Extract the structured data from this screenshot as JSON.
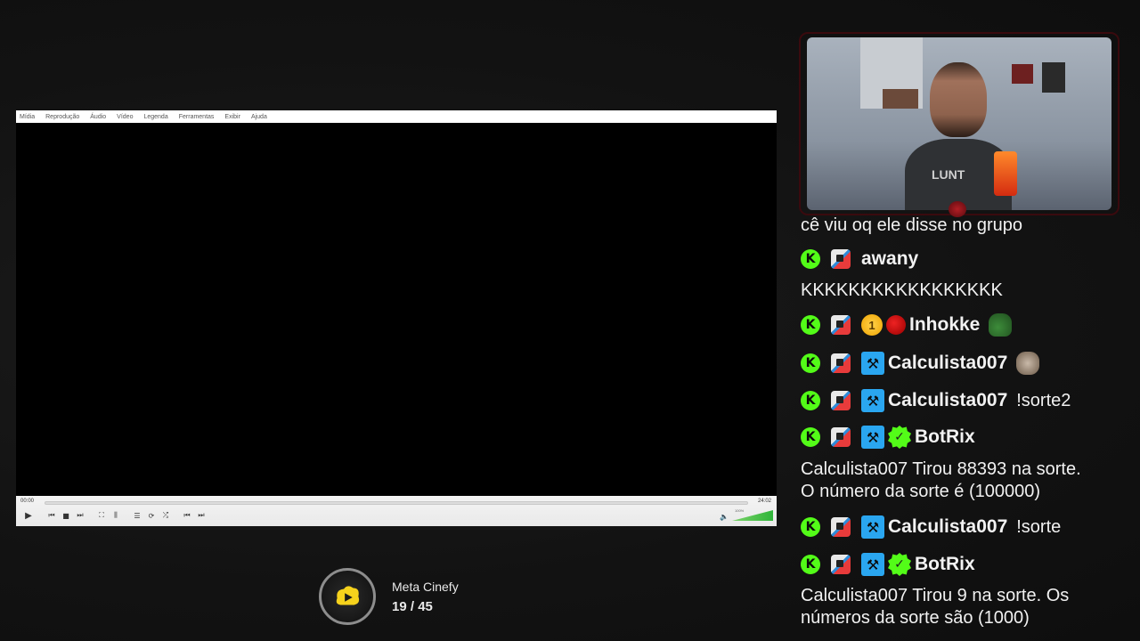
{
  "vlc": {
    "menu": [
      "Mídia",
      "Reprodução",
      "Áudio",
      "Vídeo",
      "Legenda",
      "Ferramentas",
      "Exibir",
      "Ajuda"
    ],
    "time_current": "00:00",
    "time_total": "24:02",
    "volume_label": "100%",
    "volume": 1.0,
    "progress": 0.0
  },
  "meta": {
    "title": "Meta Cinefy",
    "current": "19",
    "separator": "/",
    "total": "45"
  },
  "cam": {
    "shirt_text": "LUNT"
  },
  "chat": {
    "cut_line": "cê viu oq ele disse no grupo",
    "messages": [
      {
        "user": "awany",
        "badges": [
          "kick-verified",
          "og"
        ],
        "text": ""
      },
      {
        "line": "KKKKKKKKKKKKKKKKK"
      },
      {
        "user": "Inhokke",
        "badges": [
          "kick-verified",
          "og",
          "gift",
          "ladybug"
        ],
        "gift_count": "1",
        "emote": "frog-emote"
      },
      {
        "user": "Calculista007",
        "badges": [
          "kick-verified",
          "og",
          "moderator"
        ],
        "emote": "cat-emote"
      },
      {
        "user": "Calculista007",
        "badges": [
          "kick-verified",
          "og",
          "moderator"
        ],
        "text": "!sorte2"
      },
      {
        "user": "BotRix",
        "badges": [
          "kick-verified",
          "og",
          "moderator",
          "verified"
        ]
      },
      {
        "line": "Calculista007 Tirou 88393 na sorte.\nO número da sorte é (100000)"
      },
      {
        "user": "Calculista007",
        "badges": [
          "kick-verified",
          "og",
          "moderator"
        ],
        "text": "!sorte"
      },
      {
        "user": "BotRix",
        "badges": [
          "kick-verified",
          "og",
          "moderator",
          "verified"
        ]
      },
      {
        "line": "Calculista007 Tirou 9 na sorte. Os\nnúmeros da sorte são (1000)"
      }
    ]
  },
  "colors": {
    "kick_green": "#53fc18",
    "moderator_blue": "#2aa6f0",
    "background": "#141414"
  }
}
